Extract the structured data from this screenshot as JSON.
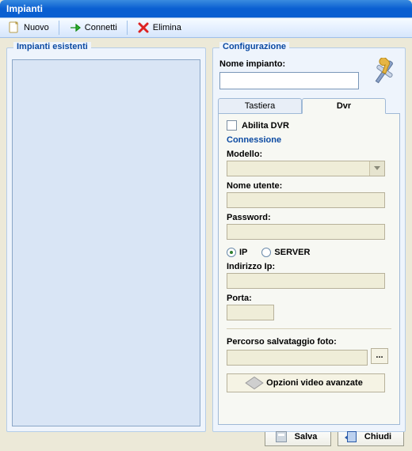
{
  "window": {
    "title": "Impianti"
  },
  "toolbar": {
    "nuovo": "Nuovo",
    "connetti": "Connetti",
    "elimina": "Elimina"
  },
  "left_panel": {
    "title": "Impianti esistenti"
  },
  "config": {
    "title": "Configurazione",
    "nome_label": "Nome impianto:",
    "nome_value": "",
    "tabs": {
      "tastiera": "Tastiera",
      "dvr": "Dvr",
      "active": "dvr"
    },
    "dvr": {
      "abilita_label": "Abilita DVR",
      "abilita_checked": false,
      "connessione_title": "Connessione",
      "modello_label": "Modello:",
      "modello_value": "",
      "nome_utente_label": "Nome utente:",
      "nome_utente_value": "",
      "password_label": "Password:",
      "password_value": "",
      "radio_ip_label": "IP",
      "radio_server_label": "SERVER",
      "radio_selected": "ip",
      "indirizzo_label": "Indirizzo Ip:",
      "indirizzo_value": "",
      "porta_label": "Porta:",
      "porta_value": "",
      "percorso_label": "Percorso salvataggio foto:",
      "percorso_value": "",
      "browse_label": "...",
      "opzioni_video_label": "Opzioni  video avanzate"
    }
  },
  "footer": {
    "salva": "Salva",
    "chiudi": "Chiudi"
  }
}
